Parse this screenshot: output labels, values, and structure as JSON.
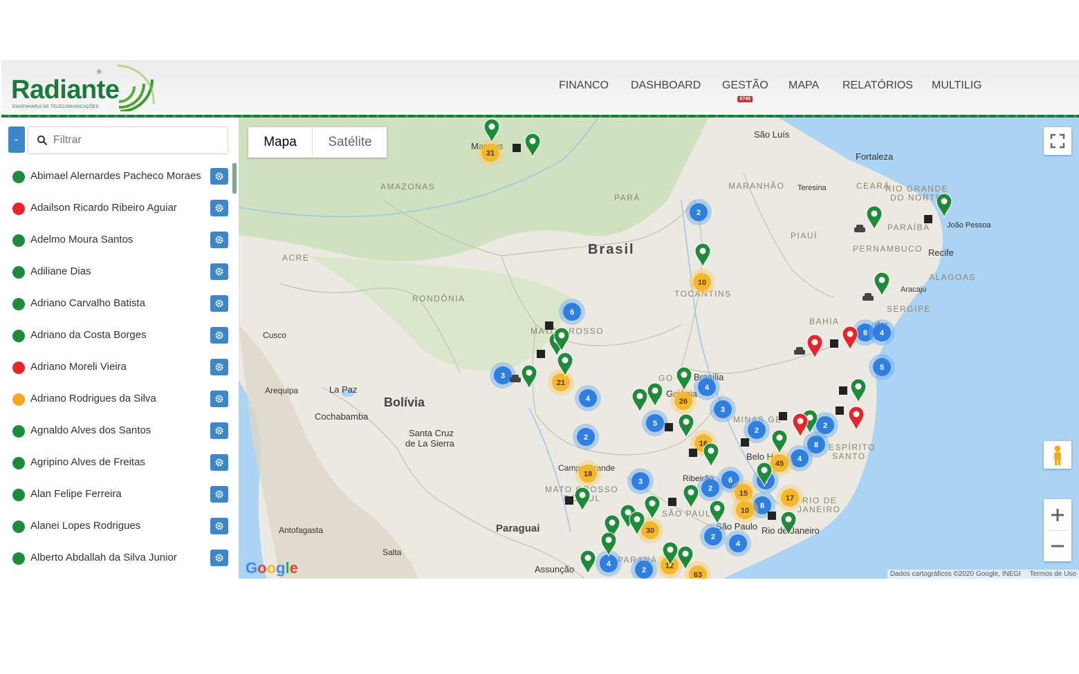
{
  "brand": {
    "name": "Radiante",
    "tagline": "ENGENHARIA DE TELECOMUNICAÇÕES",
    "reg": "®",
    "color": "#1a7a3a"
  },
  "nav": [
    {
      "label": "FINANCO"
    },
    {
      "label": "DASHBOARD"
    },
    {
      "label": "GESTÃO",
      "badge": "6745"
    },
    {
      "label": "MAPA"
    },
    {
      "label": "RELATÓRIOS"
    },
    {
      "label": "MULTILIG"
    }
  ],
  "sidebar": {
    "filter_placeholder": "Filtrar",
    "people": [
      {
        "name": "Abimael Alernardes Pacheco Moraes",
        "status": "green"
      },
      {
        "name": "Adailson Ricardo Ribeiro Aguiar",
        "status": "red"
      },
      {
        "name": "Adelmo Moura Santos",
        "status": "green"
      },
      {
        "name": "Adiliane Dias",
        "status": "green"
      },
      {
        "name": "Adriano Carvalho Batista",
        "status": "green"
      },
      {
        "name": "Adriano da Costa Borges",
        "status": "green"
      },
      {
        "name": "Adriano Moreli Vieira",
        "status": "red"
      },
      {
        "name": "Adriano Rodrigues da Silva",
        "status": "orange"
      },
      {
        "name": "Agnaldo Alves dos Santos",
        "status": "green"
      },
      {
        "name": "Agripino Alves de Freitas",
        "status": "green"
      },
      {
        "name": "Alan Felipe Ferreira",
        "status": "green"
      },
      {
        "name": "Alanei Lopes Rodrigues",
        "status": "green"
      },
      {
        "name": "Alberto Abdallah da Silva Junior",
        "status": "green"
      }
    ]
  },
  "status_colors": {
    "green": "#1e8a3a",
    "red": "#e8232a",
    "orange": "#f5a623"
  },
  "accent": "#3b87c8",
  "map": {
    "type_buttons": {
      "map": "Mapa",
      "satellite": "Satélite"
    },
    "labels": {
      "brasil": "Brasil",
      "bolivia": "Bolívia",
      "paraguai": "Paraguai",
      "amazonas": "AMAZONAS",
      "para": "PARÁ",
      "acre": "ACRE",
      "rondonia": "RONDÔNIA",
      "maranhao": "MARANHÃO",
      "piaui": "PIAUÍ",
      "ceara": "CEARÁ",
      "rn": "RIO GRANDE",
      "rn2": "DO NORTE",
      "paraiba": "PARAÍBA",
      "pernambuco": "PERNAMBUCO",
      "alagoas": "ALAGOAS",
      "sergipe": "SERGIPE",
      "bahia": "BAHIA",
      "tocantins": "TOCANTINS",
      "mato_grosso": "MATO GROSSO",
      "goias": "GO",
      "minas": "MINAS GE",
      "es1": "ESPÍRITO",
      "es2": "SANTO",
      "ms": "MATO GROSSO",
      "ms2": "DO SUL",
      "sp": "SÃO PAUL",
      "pr": "PARANÁ",
      "rj1": "RIO DE",
      "rj2": "JANEIRO",
      "manaus": "Manaus",
      "sao_luis": "São Luís",
      "fortaleza": "Fortaleza",
      "teresina": "Teresina",
      "joao_pessoa": "João Pessoa",
      "recife": "Recife",
      "aracaju": "Aracaju",
      "salvador": "dor",
      "brasilia": "Brasília",
      "goiania": "Goiânia",
      "bh": "Belo H",
      "ribeirao": "Ribeirão",
      "campo_grande": "Campo Grande",
      "sao_paulo": "São Paulo",
      "rio": "Rio de Janeiro",
      "cusco": "Cusco",
      "la_paz": "La Paz",
      "cochabamba": "Cochabamba",
      "arequipa": "Arequipa",
      "santa_cruz1": "Santa Cruz",
      "santa_cruz2": "de La Sierra",
      "antofagasta": "Antofagasta",
      "salta": "Salta",
      "assuncao": "Assunção"
    },
    "clusters_blue": [
      "2",
      "6",
      "3",
      "4",
      "2",
      "4",
      "3",
      "5",
      "2",
      "2",
      "8",
      "4",
      "3",
      "2",
      "6",
      "4",
      "2",
      "8",
      "4",
      "4",
      "2",
      "5",
      "8",
      "4"
    ],
    "clusters_orange": [
      "31",
      "10",
      "21",
      "26",
      "16",
      "18",
      "45",
      "15",
      "10",
      "17",
      "30",
      "12",
      "63"
    ],
    "attribution": "Dados cartográficos ©2020 Google, INEGI",
    "terms": "Termos de Uso",
    "google": "Google"
  }
}
